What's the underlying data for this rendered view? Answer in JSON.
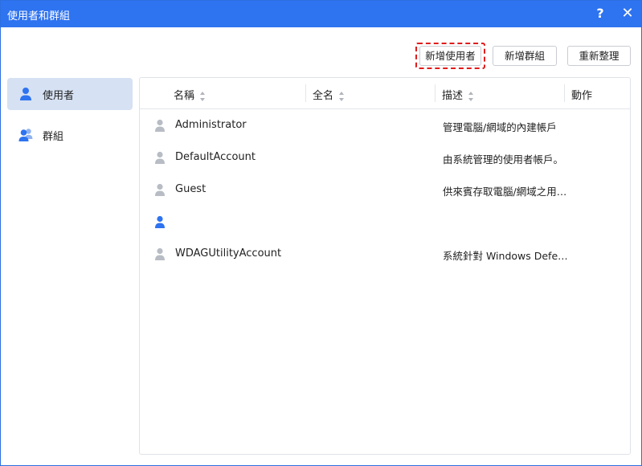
{
  "window": {
    "title": "使用者和群組",
    "help_label": "?",
    "close_label": "✕"
  },
  "toolbar": {
    "add_user_label": "新增使用者",
    "add_group_label": "新增群組",
    "refresh_label": "重新整理"
  },
  "sidebar": {
    "items": [
      {
        "label": "使用者",
        "icon": "user-icon",
        "active": true
      },
      {
        "label": "群組",
        "icon": "group-icon",
        "active": false
      }
    ]
  },
  "table": {
    "columns": [
      "名稱",
      "全名",
      "描述",
      "動作"
    ],
    "rows": [
      {
        "name": "Administrator",
        "full_name": "",
        "description": "管理電腦/網域的內建帳戶",
        "icon_color": "#b8bcc4"
      },
      {
        "name": "DefaultAccount",
        "full_name": "",
        "description": "由系統管理的使用者帳戶。",
        "icon_color": "#b8bcc4"
      },
      {
        "name": "Guest",
        "full_name": "",
        "description": "供來賓存取電腦/網域之用…",
        "icon_color": "#b8bcc4"
      },
      {
        "name": "",
        "full_name": "",
        "description": "",
        "icon_color": "#2e73f0"
      },
      {
        "name": "WDAGUtilityAccount",
        "full_name": "",
        "description": "系統針對 Windows Defen…",
        "icon_color": "#b8bcc4"
      }
    ]
  },
  "colors": {
    "accent": "#2e73f0",
    "highlight": "#e01c1c",
    "sidebar_active": "#d6e1f3"
  }
}
